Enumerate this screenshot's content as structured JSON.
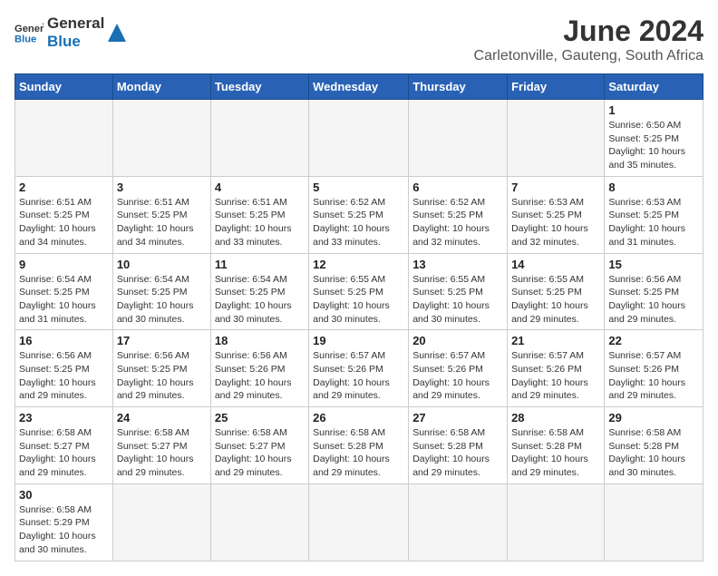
{
  "logo": {
    "text_general": "General",
    "text_blue": "Blue"
  },
  "title": "June 2024",
  "subtitle": "Carletonville, Gauteng, South Africa",
  "weekdays": [
    "Sunday",
    "Monday",
    "Tuesday",
    "Wednesday",
    "Thursday",
    "Friday",
    "Saturday"
  ],
  "weeks": [
    [
      {
        "day": "",
        "info": ""
      },
      {
        "day": "",
        "info": ""
      },
      {
        "day": "",
        "info": ""
      },
      {
        "day": "",
        "info": ""
      },
      {
        "day": "",
        "info": ""
      },
      {
        "day": "",
        "info": ""
      },
      {
        "day": "1",
        "info": "Sunrise: 6:50 AM\nSunset: 5:25 PM\nDaylight: 10 hours and 35 minutes."
      }
    ],
    [
      {
        "day": "2",
        "info": "Sunrise: 6:51 AM\nSunset: 5:25 PM\nDaylight: 10 hours and 34 minutes."
      },
      {
        "day": "3",
        "info": "Sunrise: 6:51 AM\nSunset: 5:25 PM\nDaylight: 10 hours and 34 minutes."
      },
      {
        "day": "4",
        "info": "Sunrise: 6:51 AM\nSunset: 5:25 PM\nDaylight: 10 hours and 33 minutes."
      },
      {
        "day": "5",
        "info": "Sunrise: 6:52 AM\nSunset: 5:25 PM\nDaylight: 10 hours and 33 minutes."
      },
      {
        "day": "6",
        "info": "Sunrise: 6:52 AM\nSunset: 5:25 PM\nDaylight: 10 hours and 32 minutes."
      },
      {
        "day": "7",
        "info": "Sunrise: 6:53 AM\nSunset: 5:25 PM\nDaylight: 10 hours and 32 minutes."
      },
      {
        "day": "8",
        "info": "Sunrise: 6:53 AM\nSunset: 5:25 PM\nDaylight: 10 hours and 31 minutes."
      }
    ],
    [
      {
        "day": "9",
        "info": "Sunrise: 6:54 AM\nSunset: 5:25 PM\nDaylight: 10 hours and 31 minutes."
      },
      {
        "day": "10",
        "info": "Sunrise: 6:54 AM\nSunset: 5:25 PM\nDaylight: 10 hours and 30 minutes."
      },
      {
        "day": "11",
        "info": "Sunrise: 6:54 AM\nSunset: 5:25 PM\nDaylight: 10 hours and 30 minutes."
      },
      {
        "day": "12",
        "info": "Sunrise: 6:55 AM\nSunset: 5:25 PM\nDaylight: 10 hours and 30 minutes."
      },
      {
        "day": "13",
        "info": "Sunrise: 6:55 AM\nSunset: 5:25 PM\nDaylight: 10 hours and 30 minutes."
      },
      {
        "day": "14",
        "info": "Sunrise: 6:55 AM\nSunset: 5:25 PM\nDaylight: 10 hours and 29 minutes."
      },
      {
        "day": "15",
        "info": "Sunrise: 6:56 AM\nSunset: 5:25 PM\nDaylight: 10 hours and 29 minutes."
      }
    ],
    [
      {
        "day": "16",
        "info": "Sunrise: 6:56 AM\nSunset: 5:25 PM\nDaylight: 10 hours and 29 minutes."
      },
      {
        "day": "17",
        "info": "Sunrise: 6:56 AM\nSunset: 5:25 PM\nDaylight: 10 hours and 29 minutes."
      },
      {
        "day": "18",
        "info": "Sunrise: 6:56 AM\nSunset: 5:26 PM\nDaylight: 10 hours and 29 minutes."
      },
      {
        "day": "19",
        "info": "Sunrise: 6:57 AM\nSunset: 5:26 PM\nDaylight: 10 hours and 29 minutes."
      },
      {
        "day": "20",
        "info": "Sunrise: 6:57 AM\nSunset: 5:26 PM\nDaylight: 10 hours and 29 minutes."
      },
      {
        "day": "21",
        "info": "Sunrise: 6:57 AM\nSunset: 5:26 PM\nDaylight: 10 hours and 29 minutes."
      },
      {
        "day": "22",
        "info": "Sunrise: 6:57 AM\nSunset: 5:26 PM\nDaylight: 10 hours and 29 minutes."
      }
    ],
    [
      {
        "day": "23",
        "info": "Sunrise: 6:58 AM\nSunset: 5:27 PM\nDaylight: 10 hours and 29 minutes."
      },
      {
        "day": "24",
        "info": "Sunrise: 6:58 AM\nSunset: 5:27 PM\nDaylight: 10 hours and 29 minutes."
      },
      {
        "day": "25",
        "info": "Sunrise: 6:58 AM\nSunset: 5:27 PM\nDaylight: 10 hours and 29 minutes."
      },
      {
        "day": "26",
        "info": "Sunrise: 6:58 AM\nSunset: 5:28 PM\nDaylight: 10 hours and 29 minutes."
      },
      {
        "day": "27",
        "info": "Sunrise: 6:58 AM\nSunset: 5:28 PM\nDaylight: 10 hours and 29 minutes."
      },
      {
        "day": "28",
        "info": "Sunrise: 6:58 AM\nSunset: 5:28 PM\nDaylight: 10 hours and 29 minutes."
      },
      {
        "day": "29",
        "info": "Sunrise: 6:58 AM\nSunset: 5:28 PM\nDaylight: 10 hours and 30 minutes."
      }
    ],
    [
      {
        "day": "30",
        "info": "Sunrise: 6:58 AM\nSunset: 5:29 PM\nDaylight: 10 hours and 30 minutes."
      },
      {
        "day": "",
        "info": ""
      },
      {
        "day": "",
        "info": ""
      },
      {
        "day": "",
        "info": ""
      },
      {
        "day": "",
        "info": ""
      },
      {
        "day": "",
        "info": ""
      },
      {
        "day": "",
        "info": ""
      }
    ]
  ]
}
